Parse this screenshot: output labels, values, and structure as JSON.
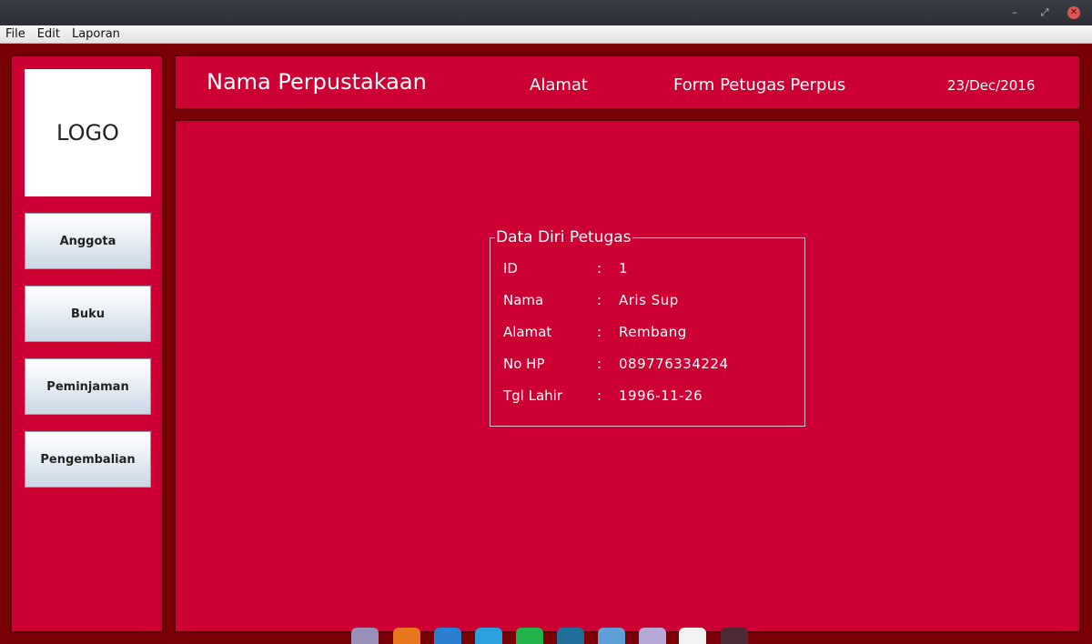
{
  "window": {
    "controls": [
      "minimize-icon",
      "maximize-icon",
      "close-icon"
    ]
  },
  "menubar": {
    "items": [
      "File",
      "Edit",
      "Laporan"
    ]
  },
  "sidebar": {
    "logo": "LOGO",
    "buttons": [
      "Anggota",
      "Buku",
      "Peminjaman",
      "Pengembalian"
    ]
  },
  "header": {
    "library_name": "Nama Perpustakaan",
    "address": "Alamat",
    "form_title": "Form Petugas Perpus",
    "date": "23/Dec/2016"
  },
  "details": {
    "legend": "Data Diri Petugas",
    "separator": ":",
    "rows": [
      {
        "label": "ID",
        "value": "1"
      },
      {
        "label": "Nama",
        "value": "Aris Sup"
      },
      {
        "label": "Alamat",
        "value": "Rembang"
      },
      {
        "label": "No HP",
        "value": "089776334224"
      },
      {
        "label": "Tgl Lahir",
        "value": "1996-11-26"
      }
    ]
  },
  "dock": {
    "icons": [
      "file-manager-icon",
      "media-player-icon",
      "document-icon",
      "telegram-icon",
      "whatsapp-icon",
      "mysql-icon",
      "virtualbox-icon",
      "text-editor-icon",
      "java-app-icon",
      "terminal-icon"
    ]
  },
  "colors": {
    "panel": "#cc0033",
    "background": "#7a0008",
    "border": "#5a0006"
  }
}
